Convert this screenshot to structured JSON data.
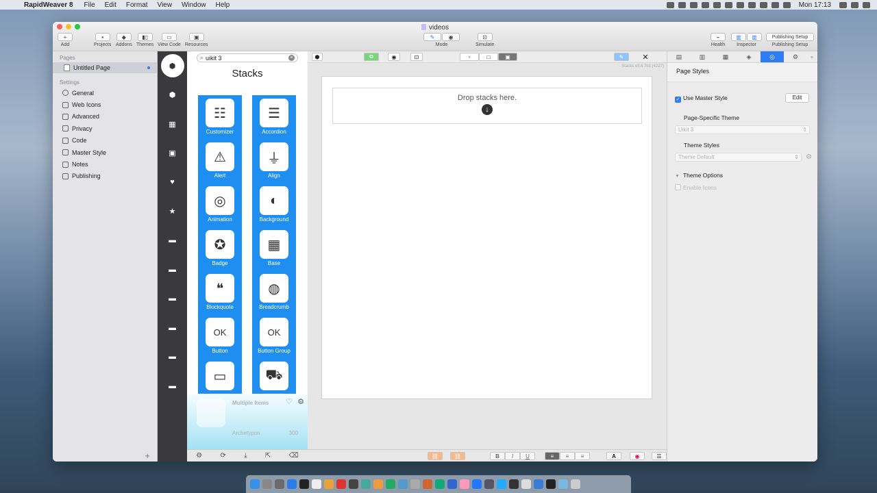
{
  "menubar": {
    "app_name": "RapidWeaver 8",
    "menus": [
      "File",
      "Edit",
      "Format",
      "View",
      "Window",
      "Help"
    ],
    "clock": "Mon 17:13"
  },
  "window": {
    "title": "videos",
    "toolbar": {
      "add": "Add",
      "projects": "Projects",
      "addons": "Addons",
      "themes": "Themes",
      "view_code": "View Code",
      "resources": "Resources",
      "mode": "Mode",
      "simulate": "Simulate",
      "health": "Health",
      "inspector": "Inspector",
      "publishing_setup_btn": "Publishing Setup",
      "publishing_setup": "Publishing Setup"
    }
  },
  "sidebar": {
    "pages_header": "Pages",
    "page": "Untitled Page",
    "settings_header": "Settings",
    "settings": [
      "General",
      "Web Icons",
      "Advanced",
      "Privacy",
      "Code",
      "Master Style",
      "Notes",
      "Publishing"
    ]
  },
  "library": {
    "search_value": "uikit 3",
    "heading": "Stacks",
    "tiles": [
      {
        "label": "Customizer",
        "glyph": "☷"
      },
      {
        "label": "Accordion",
        "glyph": "☰"
      },
      {
        "label": "Alert",
        "glyph": "⚠"
      },
      {
        "label": "Align",
        "glyph": "⏚"
      },
      {
        "label": "Animation",
        "glyph": "◎"
      },
      {
        "label": "Background",
        "glyph": "◐"
      },
      {
        "label": "Badge",
        "glyph": "✪"
      },
      {
        "label": "Base",
        "glyph": "▦"
      },
      {
        "label": "Blockquote",
        "glyph": "❝"
      },
      {
        "label": "Breadcrumb",
        "glyph": "◍"
      },
      {
        "label": "Button",
        "glyph": "OK"
      },
      {
        "label": "Button Group",
        "glyph": "OK"
      },
      {
        "label": "",
        "glyph": "▭"
      },
      {
        "label": "",
        "glyph": "⛟"
      }
    ],
    "preview": {
      "title": "Multiple Items",
      "author": "Archetypon",
      "count": "300"
    }
  },
  "canvas": {
    "version": "Stacks v3.6.7b1 (4227)",
    "drop_text": "Drop stacks here."
  },
  "inspector": {
    "header": "Page Styles",
    "use_master_style": "Use Master Style",
    "edit": "Edit",
    "page_specific_theme_label": "Page-Specific Theme",
    "page_specific_theme_value": "Uikit 3",
    "theme_styles_label": "Theme Styles",
    "theme_styles_value": "Theme Default",
    "theme_options_label": "Theme Options",
    "enable_icons": "Enable Icons"
  },
  "colors": {
    "accent": "#2f7cf6",
    "tile_blue": "#1f8ef1",
    "dark_strip": "#3a3a3c"
  }
}
